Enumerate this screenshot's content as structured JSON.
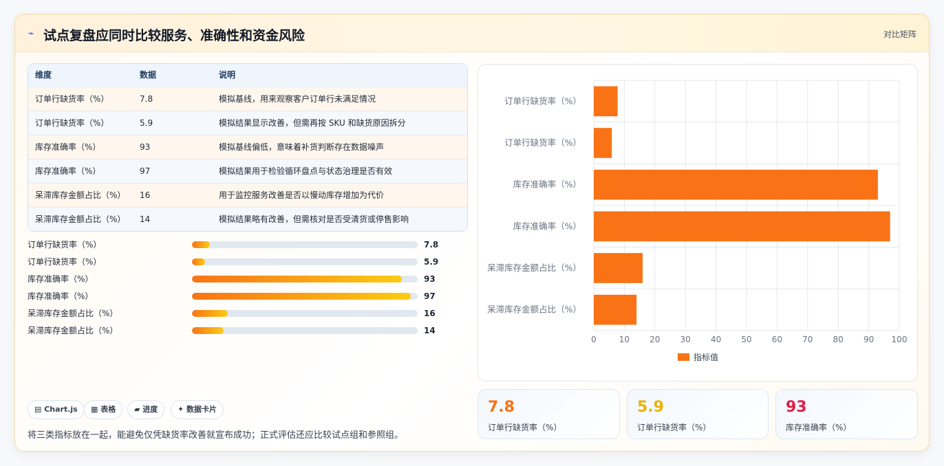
{
  "header": {
    "icon": "pulse-icon",
    "title": "试点复盘应同时比较服务、准确性和资金风险",
    "tag": "对比矩阵"
  },
  "table": {
    "columns": [
      "维度",
      "数据",
      "说明"
    ],
    "rows": [
      {
        "dim": "订单行缺货率（%）",
        "value": "7.8",
        "note": "模拟基线，用来观察客户订单行未满足情况"
      },
      {
        "dim": "订单行缺货率（%）",
        "value": "5.9",
        "note": "模拟结果显示改善，但需再按 SKU 和缺货原因拆分"
      },
      {
        "dim": "库存准确率（%）",
        "value": "93",
        "note": "模拟基线偏低，意味着补货判断存在数据噪声"
      },
      {
        "dim": "库存准确率（%）",
        "value": "97",
        "note": "模拟结果用于检验循环盘点与状态治理是否有效"
      },
      {
        "dim": "呆滞库存金额占比（%）",
        "value": "16",
        "note": "用于监控服务改善是否以慢动库存增加为代价"
      },
      {
        "dim": "呆滞库存金额占比（%）",
        "value": "14",
        "note": "模拟结果略有改善，但需核对是否受清货或停售影响"
      }
    ]
  },
  "progress": [
    {
      "label": "订单行缺货率（%）",
      "value": 7.8,
      "text": "7.8"
    },
    {
      "label": "订单行缺货率（%）",
      "value": 5.9,
      "text": "5.9"
    },
    {
      "label": "库存准确率（%）",
      "value": 93,
      "text": "93"
    },
    {
      "label": "库存准确率（%）",
      "value": 97,
      "text": "97"
    },
    {
      "label": "呆滞库存金额占比（%）",
      "value": 16,
      "text": "16"
    },
    {
      "label": "呆滞库存金额占比（%）",
      "value": 14,
      "text": "14"
    }
  ],
  "chips": [
    "▤ Chart.js",
    "▦ 表格",
    "▰ 进度",
    "✦ 数据卡片"
  ],
  "footnote": "将三类指标放在一起，能避免仅凭缺货率改善就宣布成功；正式评估还应比较试点组和参照组。",
  "chart_data": {
    "type": "bar",
    "orientation": "horizontal",
    "categories": [
      "订单行缺货率（%）",
      "订单行缺货率（%）",
      "库存准确率（%）",
      "库存准确率（%）",
      "呆滞库存金额占比（%）",
      "呆滞库存金额占比（%）"
    ],
    "series": [
      {
        "name": "指标值",
        "values": [
          7.8,
          5.9,
          93,
          97,
          16,
          14
        ]
      }
    ],
    "xlim": [
      0,
      100
    ],
    "xticks": [
      "0",
      "10",
      "20",
      "30",
      "40",
      "50",
      "60",
      "70",
      "80",
      "90",
      "100"
    ],
    "grid": true,
    "legend": "bottom",
    "color": "#f97316"
  },
  "metrics": [
    {
      "value": "7.8",
      "label": "订单行缺货率（%）",
      "color": "#f97316"
    },
    {
      "value": "5.9",
      "label": "订单行缺货率（%）",
      "color": "#eab308"
    },
    {
      "value": "93",
      "label": "库存准确率（%）",
      "color": "#e11d48"
    }
  ]
}
